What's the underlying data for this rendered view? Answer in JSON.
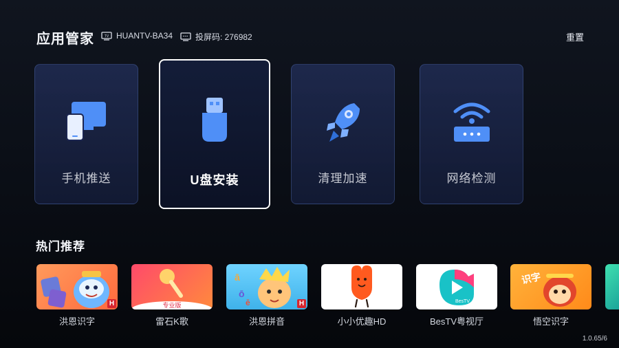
{
  "header": {
    "title": "应用管家",
    "device_name": "HUANTV-BA34",
    "cast_code": "投屏码: 276982",
    "reset_label": "重置",
    "device_icon_label": "TV"
  },
  "features": [
    {
      "label": "手机推送",
      "icon": "phone-screen-icon"
    },
    {
      "label": "U盘安装",
      "icon": "usb-drive-icon",
      "focused": true
    },
    {
      "label": "清理加速",
      "icon": "rocket-icon"
    },
    {
      "label": "网络检测",
      "icon": "wifi-router-icon"
    }
  ],
  "recommend": {
    "title": "热门推荐",
    "apps": [
      {
        "name": "洪恩识字",
        "badge": "H"
      },
      {
        "name": "雷石K歌",
        "tag": "专业版"
      },
      {
        "name": "洪恩拼音",
        "badge": "H"
      },
      {
        "name": "小小优趣HD"
      },
      {
        "name": "BesTV粤视厅",
        "logo_text": "BesTV"
      },
      {
        "name": "悟空识字",
        "logo_text": "识字"
      }
    ]
  },
  "version": "1.0.65/6",
  "colors": {
    "accent_blue": "#4f8ff7",
    "card_border": "#ffffff",
    "badge_red": "#d7262f"
  }
}
